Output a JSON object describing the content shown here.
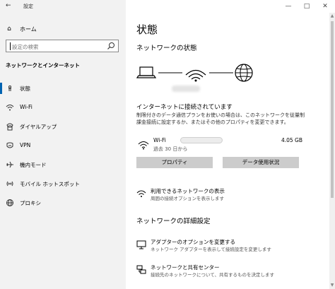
{
  "window": {
    "title": "設定",
    "minimize_icon": "minimize-icon",
    "maximize_icon": "maximize-icon",
    "close_icon": "close-icon"
  },
  "sidebar": {
    "home_label": "ホーム",
    "search_placeholder": "設定の検索",
    "section_title": "ネットワークとインターネット",
    "items": [
      {
        "label": "状態",
        "icon": "status-icon",
        "active": true
      },
      {
        "label": "Wi-Fi",
        "icon": "wifi-icon",
        "active": false
      },
      {
        "label": "ダイヤルアップ",
        "icon": "dialup-icon",
        "active": false
      },
      {
        "label": "VPN",
        "icon": "vpn-icon",
        "active": false
      },
      {
        "label": "機内モード",
        "icon": "airplane-icon",
        "active": false
      },
      {
        "label": "モバイル ホットスポット",
        "icon": "hotspot-icon",
        "active": false
      },
      {
        "label": "プロキシ",
        "icon": "proxy-icon",
        "active": false
      }
    ]
  },
  "main": {
    "title": "状態",
    "network_status_heading": "ネットワークの状態",
    "connected_heading": "インターネットに接続されています",
    "description": "制限付きのデータ通信プランをお使いの場合は、このネットワークを従量制課金接続に設定するか、またはその他のプロパティを変更できます。",
    "connection": {
      "name": "Wi-Fi",
      "duration": "過去 30 日から",
      "data_usage": "4.05 GB"
    },
    "buttons": {
      "properties": "プロパティ",
      "data_usage": "データ使用状況"
    },
    "available_networks": {
      "title": "利用できるネットワークの表示",
      "subtitle": "周囲の接続オプションを表示します"
    },
    "advanced_heading": "ネットワークの詳細設定",
    "adapter_options": {
      "title": "アダプターのオプションを変更する",
      "subtitle": "ネットワーク アダプターを表示して接続設定を変更します"
    },
    "sharing_center": {
      "title": "ネットワークと共有センター",
      "subtitle": "接続先のネットワークについて、共有するものを決定します"
    }
  },
  "colors": {
    "accent": "#0063b1",
    "sidebar_bg": "#f2f2f2",
    "button_bg": "#cccccc"
  }
}
